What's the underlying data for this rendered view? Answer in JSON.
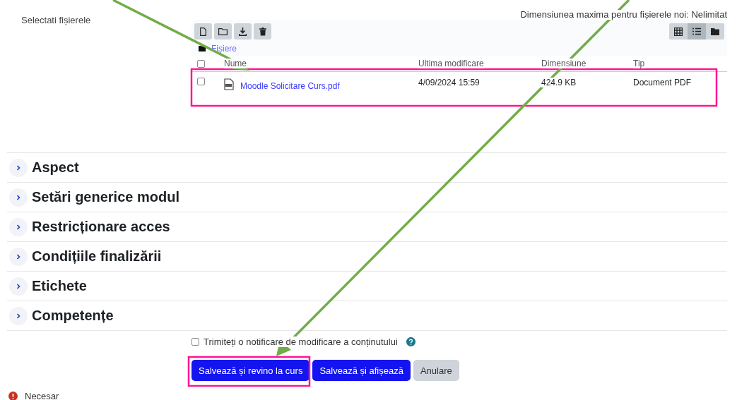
{
  "upload": {
    "label": "Selectati fișierele",
    "max_size": "Dimensiunea maxima pentru fișierele noi: Nelimitat",
    "views": [
      {
        "kind": "grid",
        "selected": false
      },
      {
        "kind": "list",
        "selected": true
      },
      {
        "kind": "tree",
        "selected": false
      }
    ],
    "path": "Fișiere",
    "select_all": false,
    "columns": [
      "Nume",
      "Ultima modificare",
      "Dimensiune",
      "Tip"
    ],
    "files": [
      {
        "name": "Moodle Solicitare Curs.pdf",
        "modified": "4/09/2024 15:59",
        "size": "424.9 KB",
        "type": "Document PDF",
        "checked": false
      }
    ]
  },
  "sections": [
    {
      "title": "Aspect",
      "expanded": false
    },
    {
      "title": "Setări generice modul",
      "expanded": false
    },
    {
      "title": "Restricționare acces",
      "expanded": false
    },
    {
      "title": "Condițiile finalizării",
      "expanded": false
    },
    {
      "title": "Etichete",
      "expanded": false
    },
    {
      "title": "Competențe",
      "expanded": false
    }
  ],
  "notify": {
    "label": "Trimiteți o notificare de modificare a conținutului",
    "checked": false
  },
  "buttons": [
    {
      "label": "Salvează și revino la curs",
      "kind": "primary"
    },
    {
      "label": "Salvează și afișează",
      "kind": "primary"
    },
    {
      "label": "Anulare",
      "kind": "secondary"
    }
  ],
  "required_note": "Necesar"
}
